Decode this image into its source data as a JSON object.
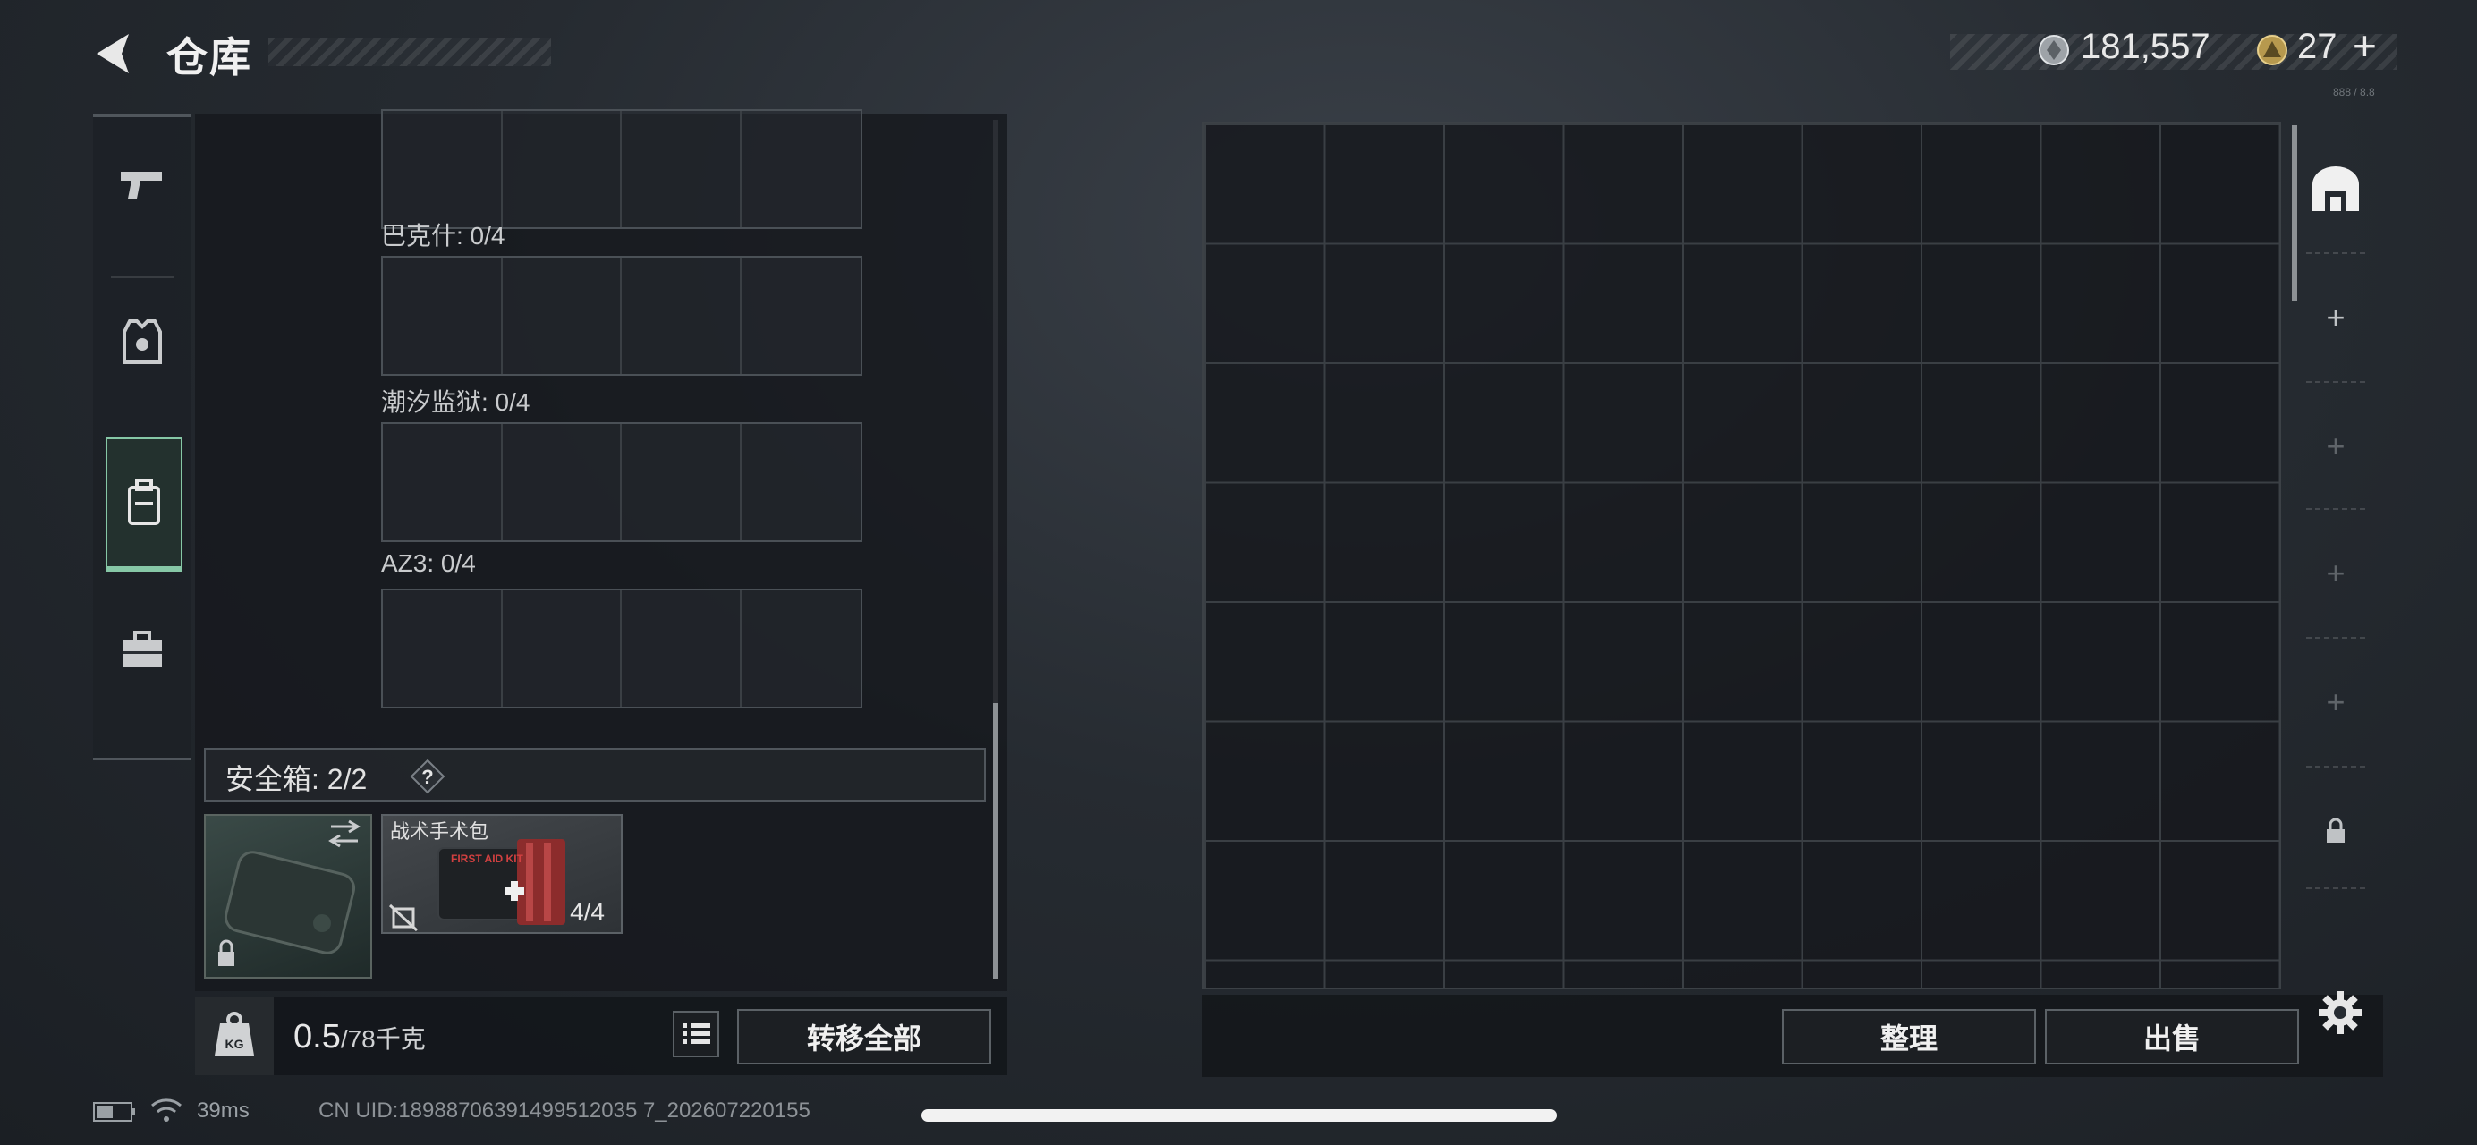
{
  "header": {
    "title": "仓库",
    "silver_value": "181,557",
    "gold_value": "27",
    "gold_plus": "+",
    "tiny_text": "888 / 8.8"
  },
  "left_panel": {
    "slots": [
      {
        "label": "巴克什: 0/4"
      },
      {
        "label": "潮汐监狱: 0/4"
      },
      {
        "label": "AZ3: 0/4"
      }
    ],
    "safe_box": {
      "label": "安全箱: 2/2",
      "help": "?"
    },
    "kit": {
      "name": "战术手术包",
      "count": "4/4"
    },
    "weight": {
      "current": "0.5",
      "total": "/78千克"
    },
    "transfer_all_label": "转移全部"
  },
  "storage": {
    "sort_label": "整理",
    "sell_label": "出售",
    "tabs": [
      "+",
      "+",
      "+",
      "+"
    ]
  },
  "status": {
    "ping": "39ms",
    "uid": "CN UID:18988706391499512035 7_202607220155"
  },
  "colors": {
    "accent_active": "#86c7a6",
    "background": "#262b31"
  }
}
